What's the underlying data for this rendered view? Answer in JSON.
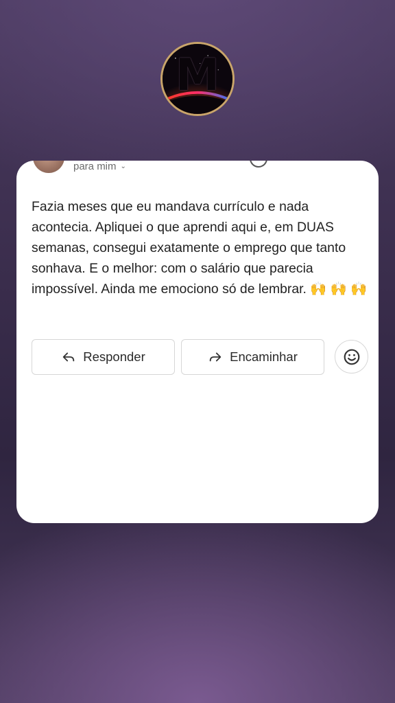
{
  "logo": {
    "letter": "M"
  },
  "email": {
    "recipient_label": "para mim",
    "body": "Fazia meses que eu mandava currículo e nada acontecia. Apliquei o que aprendi aqui e, em DUAS semanas, consegui exatamente o emprego que tanto sonhava. E o melhor: com o salário que parecia impossível. Ainda me emociono só de lembrar. 🙌 🙌 🙌"
  },
  "actions": {
    "reply_label": "Responder",
    "forward_label": "Encaminhar",
    "emoji_icon": "smiley-icon",
    "reply_icon": "reply-arrow-icon",
    "forward_icon": "forward-arrow-icon"
  },
  "colors": {
    "background": "#3a2d4c",
    "card": "#ffffff",
    "logo_ring": "#c9a56a"
  }
}
